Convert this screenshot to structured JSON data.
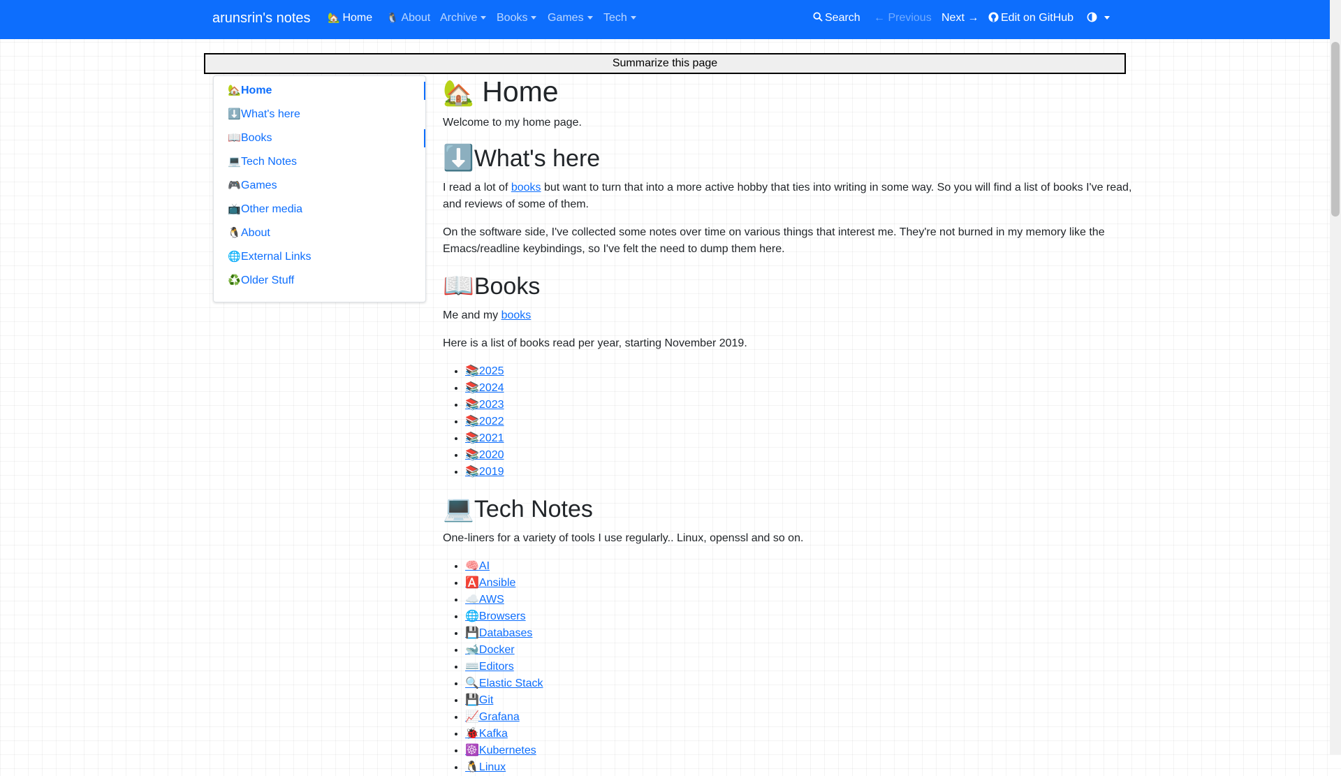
{
  "navbar": {
    "brand": "arunsrin's notes",
    "items": [
      {
        "icon": "house-icon",
        "glyph": "🏡",
        "label": "Home"
      },
      {
        "icon": "penguin-icon",
        "glyph": "🐧",
        "label": "About"
      },
      {
        "label": "Archive"
      },
      {
        "label": "Books"
      },
      {
        "label": "Games"
      },
      {
        "label": "Tech"
      }
    ],
    "search": "Search",
    "previous": "Previous",
    "next": "Next",
    "edit": "Edit on GitHub"
  },
  "summarize_label": "Summarize this page",
  "sidebar": {
    "items": [
      {
        "glyph": "🏡",
        "label": "Home"
      },
      {
        "glyph": "⬇️",
        "label": "What's here"
      },
      {
        "glyph": "📖",
        "label": "Books"
      },
      {
        "glyph": "💻",
        "label": "Tech Notes"
      },
      {
        "glyph": "🎮",
        "label": "Games"
      },
      {
        "glyph": "📺",
        "label": "Other media"
      },
      {
        "glyph": "🐧",
        "label": "About"
      },
      {
        "glyph": "🌐",
        "label": "External Links"
      },
      {
        "glyph": "♻️",
        "label": "Older Stuff"
      }
    ]
  },
  "main": {
    "title": {
      "glyph": "🏡",
      "text": "Home"
    },
    "welcome": "Welcome to my home page.",
    "whats_here": {
      "glyph": "⬇️",
      "heading": "What's here",
      "p1_before": "I read a lot of ",
      "p1_link": "books",
      "p1_after": " but want to turn that into a more active hobby that ties into writing in some way. So you will find a list of books I've read, and reviews of some of them.",
      "p2": "On the software side, I've collected some notes over time on various things that interest me. They're not burned in my memory like the Emacs/readline keybindings, so I've felt the need to dump them here."
    },
    "books": {
      "glyph": "📖",
      "heading": "Books",
      "p1_before": "Me and my ",
      "p1_link": "books",
      "p2": "Here is a list of books read per year, starting November 2019.",
      "years": [
        "2025",
        "2024",
        "2023",
        "2022",
        "2021",
        "2020",
        "2019"
      ]
    },
    "tech": {
      "glyph": "💻",
      "heading": "Tech Notes",
      "intro": "One-liners for a variety of tools I use regularly.. Linux, openssl and so on.",
      "items": [
        {
          "glyph": "🧠",
          "label": "AI"
        },
        {
          "glyph": "🅰️",
          "label": "Ansible"
        },
        {
          "glyph": "☁️",
          "label": "AWS"
        },
        {
          "glyph": "🌐",
          "label": "Browsers"
        },
        {
          "glyph": "💾",
          "label": "Databases"
        },
        {
          "glyph": "🐋",
          "label": "Docker"
        },
        {
          "glyph": "⌨️",
          "label": "Editors"
        },
        {
          "glyph": "🔍",
          "label": "Elastic Stack"
        },
        {
          "glyph": "💾",
          "label": "Git"
        },
        {
          "glyph": "📈",
          "label": "Grafana"
        },
        {
          "glyph": "🐞",
          "label": "Kafka"
        },
        {
          "glyph": "☸️",
          "label": "Kubernetes"
        },
        {
          "glyph": "🐧",
          "label": "Linux"
        }
      ]
    }
  },
  "colors": {
    "navbar": "#0d6efd",
    "link": "#0d6efd"
  }
}
